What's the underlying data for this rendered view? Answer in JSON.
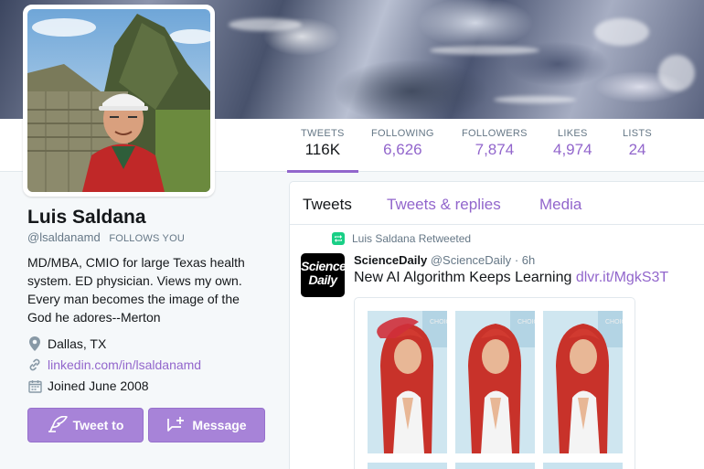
{
  "profile": {
    "name": "Luis Saldana",
    "handle": "@lsaldanamd",
    "follows_you": "FOLLOWS YOU",
    "bio_lines": [
      "MD/MBA, CMIO for large Texas health",
      "system. ED physician. Views my own.",
      "Every man becomes the image of the",
      "God he adores--Merton"
    ],
    "location": "Dallas, TX",
    "website": "linkedin.com/in/lsaldanamd",
    "joined": "Joined June 2008",
    "tweet_to_label": "Tweet to",
    "message_label": "Message"
  },
  "stats": [
    {
      "label": "TWEETS",
      "value": "116K",
      "active": true
    },
    {
      "label": "FOLLOWING",
      "value": "6,626"
    },
    {
      "label": "FOLLOWERS",
      "value": "7,874"
    },
    {
      "label": "LIKES",
      "value": "4,974"
    },
    {
      "label": "LISTS",
      "value": "24"
    }
  ],
  "timeline": {
    "tabs": [
      "Tweets",
      "Tweets & replies",
      "Media"
    ],
    "retweet_note": "Luis Saldana Retweeted",
    "tweet": {
      "logo_line1": "Science",
      "logo_line2": "Daily",
      "author": "ScienceDaily",
      "handle": "@ScienceDaily",
      "sep": "·",
      "time": "6h",
      "text": "New AI Algorithm Keeps Learning",
      "link": "dlvr.it/MgkS3T"
    }
  },
  "colors": {
    "accent": "#9266cc",
    "button": "#a783d8",
    "retweet": "#19cf86"
  },
  "icons": {
    "location": "map-pin-icon",
    "website": "link-icon",
    "joined": "calendar-icon",
    "tweet_to": "feather-icon",
    "message": "message-icon",
    "retweet": "retweet-icon"
  }
}
